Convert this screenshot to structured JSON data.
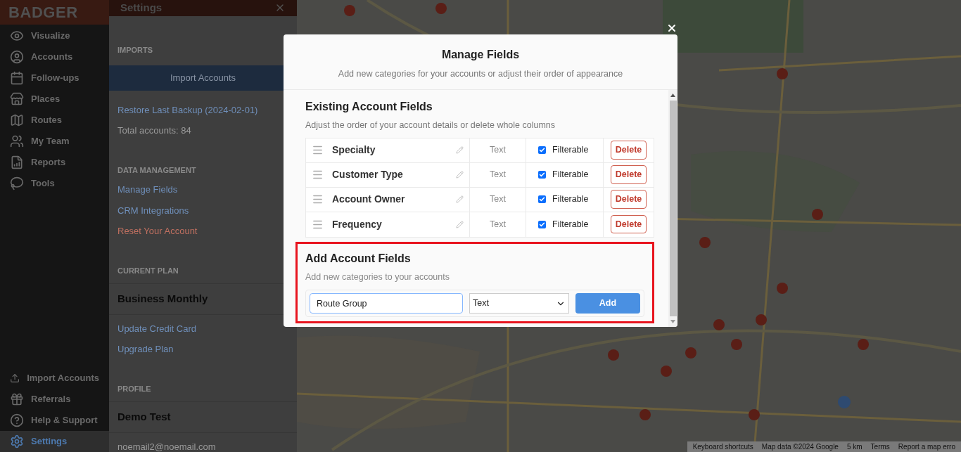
{
  "sidebar": {
    "logo": "BADGER",
    "items": [
      {
        "label": "Visualize",
        "selected": false
      },
      {
        "label": "Accounts",
        "selected": false
      },
      {
        "label": "Follow-ups",
        "selected": false
      },
      {
        "label": "Places",
        "selected": false
      },
      {
        "label": "Routes",
        "selected": false
      },
      {
        "label": "My Team",
        "selected": false
      },
      {
        "label": "Reports",
        "selected": false
      },
      {
        "label": "Tools",
        "selected": false
      }
    ],
    "bottom_items": [
      {
        "label": "Import Accounts",
        "selected": false
      },
      {
        "label": "Referrals",
        "selected": false
      },
      {
        "label": "Help & Support",
        "selected": false
      },
      {
        "label": "Settings",
        "selected": true
      }
    ]
  },
  "settings_panel": {
    "title": "Settings",
    "sections": [
      {
        "heading": "IMPORTS",
        "items": [
          {
            "kind": "button",
            "text": "Import Accounts"
          },
          {
            "kind": "link",
            "text": "Restore Last Backup (2024-02-01)"
          },
          {
            "kind": "text",
            "text": "Total accounts: 84"
          }
        ]
      },
      {
        "heading": "DATA MANAGEMENT",
        "items": [
          {
            "kind": "link",
            "text": "Manage Fields"
          },
          {
            "kind": "link",
            "text": "CRM Integrations"
          },
          {
            "kind": "danger",
            "text": "Reset Your Account"
          }
        ]
      },
      {
        "heading": "CURRENT PLAN",
        "items": [
          {
            "kind": "bold",
            "text": "Business Monthly"
          },
          {
            "kind": "link",
            "text": "Update Credit Card"
          },
          {
            "kind": "link",
            "text": "Upgrade Plan"
          }
        ]
      },
      {
        "heading": "PROFILE",
        "items": [
          {
            "kind": "bold",
            "text": "Demo Test"
          },
          {
            "kind": "text",
            "text": "noemail2@noemail.com"
          }
        ]
      }
    ]
  },
  "modal": {
    "title": "Manage Fields",
    "subtitle": "Add new categories for your accounts or adjust their order of appearance",
    "existing": {
      "heading": "Existing Account Fields",
      "subtitle": "Adjust the order of your account details or delete whole columns",
      "rows": [
        {
          "name": "Specialty",
          "type": "Text",
          "filterable": true,
          "filter_label": "Filterable",
          "delete": "Delete"
        },
        {
          "name": "Customer Type",
          "type": "Text",
          "filterable": true,
          "filter_label": "Filterable",
          "delete": "Delete"
        },
        {
          "name": "Account Owner",
          "type": "Text",
          "filterable": true,
          "filter_label": "Filterable",
          "delete": "Delete"
        },
        {
          "name": "Frequency",
          "type": "Text",
          "filterable": true,
          "filter_label": "Filterable",
          "delete": "Delete"
        }
      ]
    },
    "add": {
      "highlighted": true,
      "heading": "Add Account Fields",
      "subtitle": "Add new categories to your accounts",
      "value": "Route Group",
      "type": "Text",
      "button": "Add"
    }
  },
  "map_footer": [
    "Keyboard shortcuts",
    "Map data ©2024 Google",
    "5 km",
    "Terms",
    "Report a map erro"
  ]
}
